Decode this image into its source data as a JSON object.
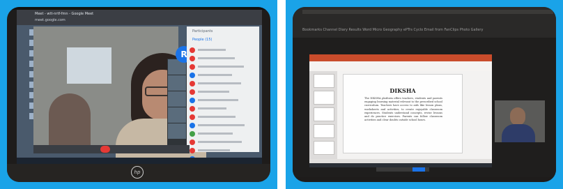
{
  "left_photo": {
    "browser_title": "Meet - wtt-nrtf-fmn - Google Meet",
    "browser_url": "meet.google.com",
    "participant_avatar_letter": "R",
    "panel_title": "Participants",
    "panel_tab": "People (15)",
    "brand_logo": "hp",
    "panel_dot_colors": [
      "#e53935",
      "#e53935",
      "#e53935",
      "#1a73e8",
      "#e53935",
      "#e53935",
      "#1a73e8",
      "#e53935",
      "#e53935",
      "#1a73e8",
      "#43a047",
      "#e53935",
      "#e53935",
      "#1a73e8"
    ]
  },
  "right_photo": {
    "bookmarks_bar": "Bookmarks  Channel Diary Results  Word  Micro Geography  ePTrs  Cyclo   Email from FanClips   Photo Gallery",
    "slide_title": "DIKSHA",
    "slide_body": "The DIKSHA platform offers teachers, students and parents engaging learning material relevant to the prescribed school curriculum. Teachers have access to aids like lesson plans, worksheets and activities, to create enjoyable classroom experiences. Students understand concepts, revise lessons and do practice exercises. Parents can follow classroom activities and clear doubts outside school hours."
  },
  "colors": {
    "frame_blue": "#1aa3e8",
    "ppt_ribbon": "#c94c2b",
    "end_call_red": "#e53935",
    "meet_blue": "#1a73e8"
  }
}
